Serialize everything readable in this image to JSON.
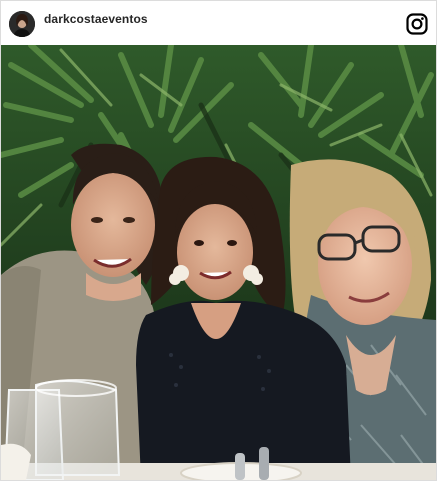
{
  "post": {
    "username": "darkcostaeventos",
    "avatar_icon": "profile-avatar",
    "platform_icon": "instagram-icon",
    "photo_subject": "three-women-smiling-at-restaurant"
  },
  "colors": {
    "foliage_dark": "#1f3b1c",
    "foliage_light": "#4d7d3a",
    "text": "#262626",
    "border": "#dcdcdc"
  }
}
